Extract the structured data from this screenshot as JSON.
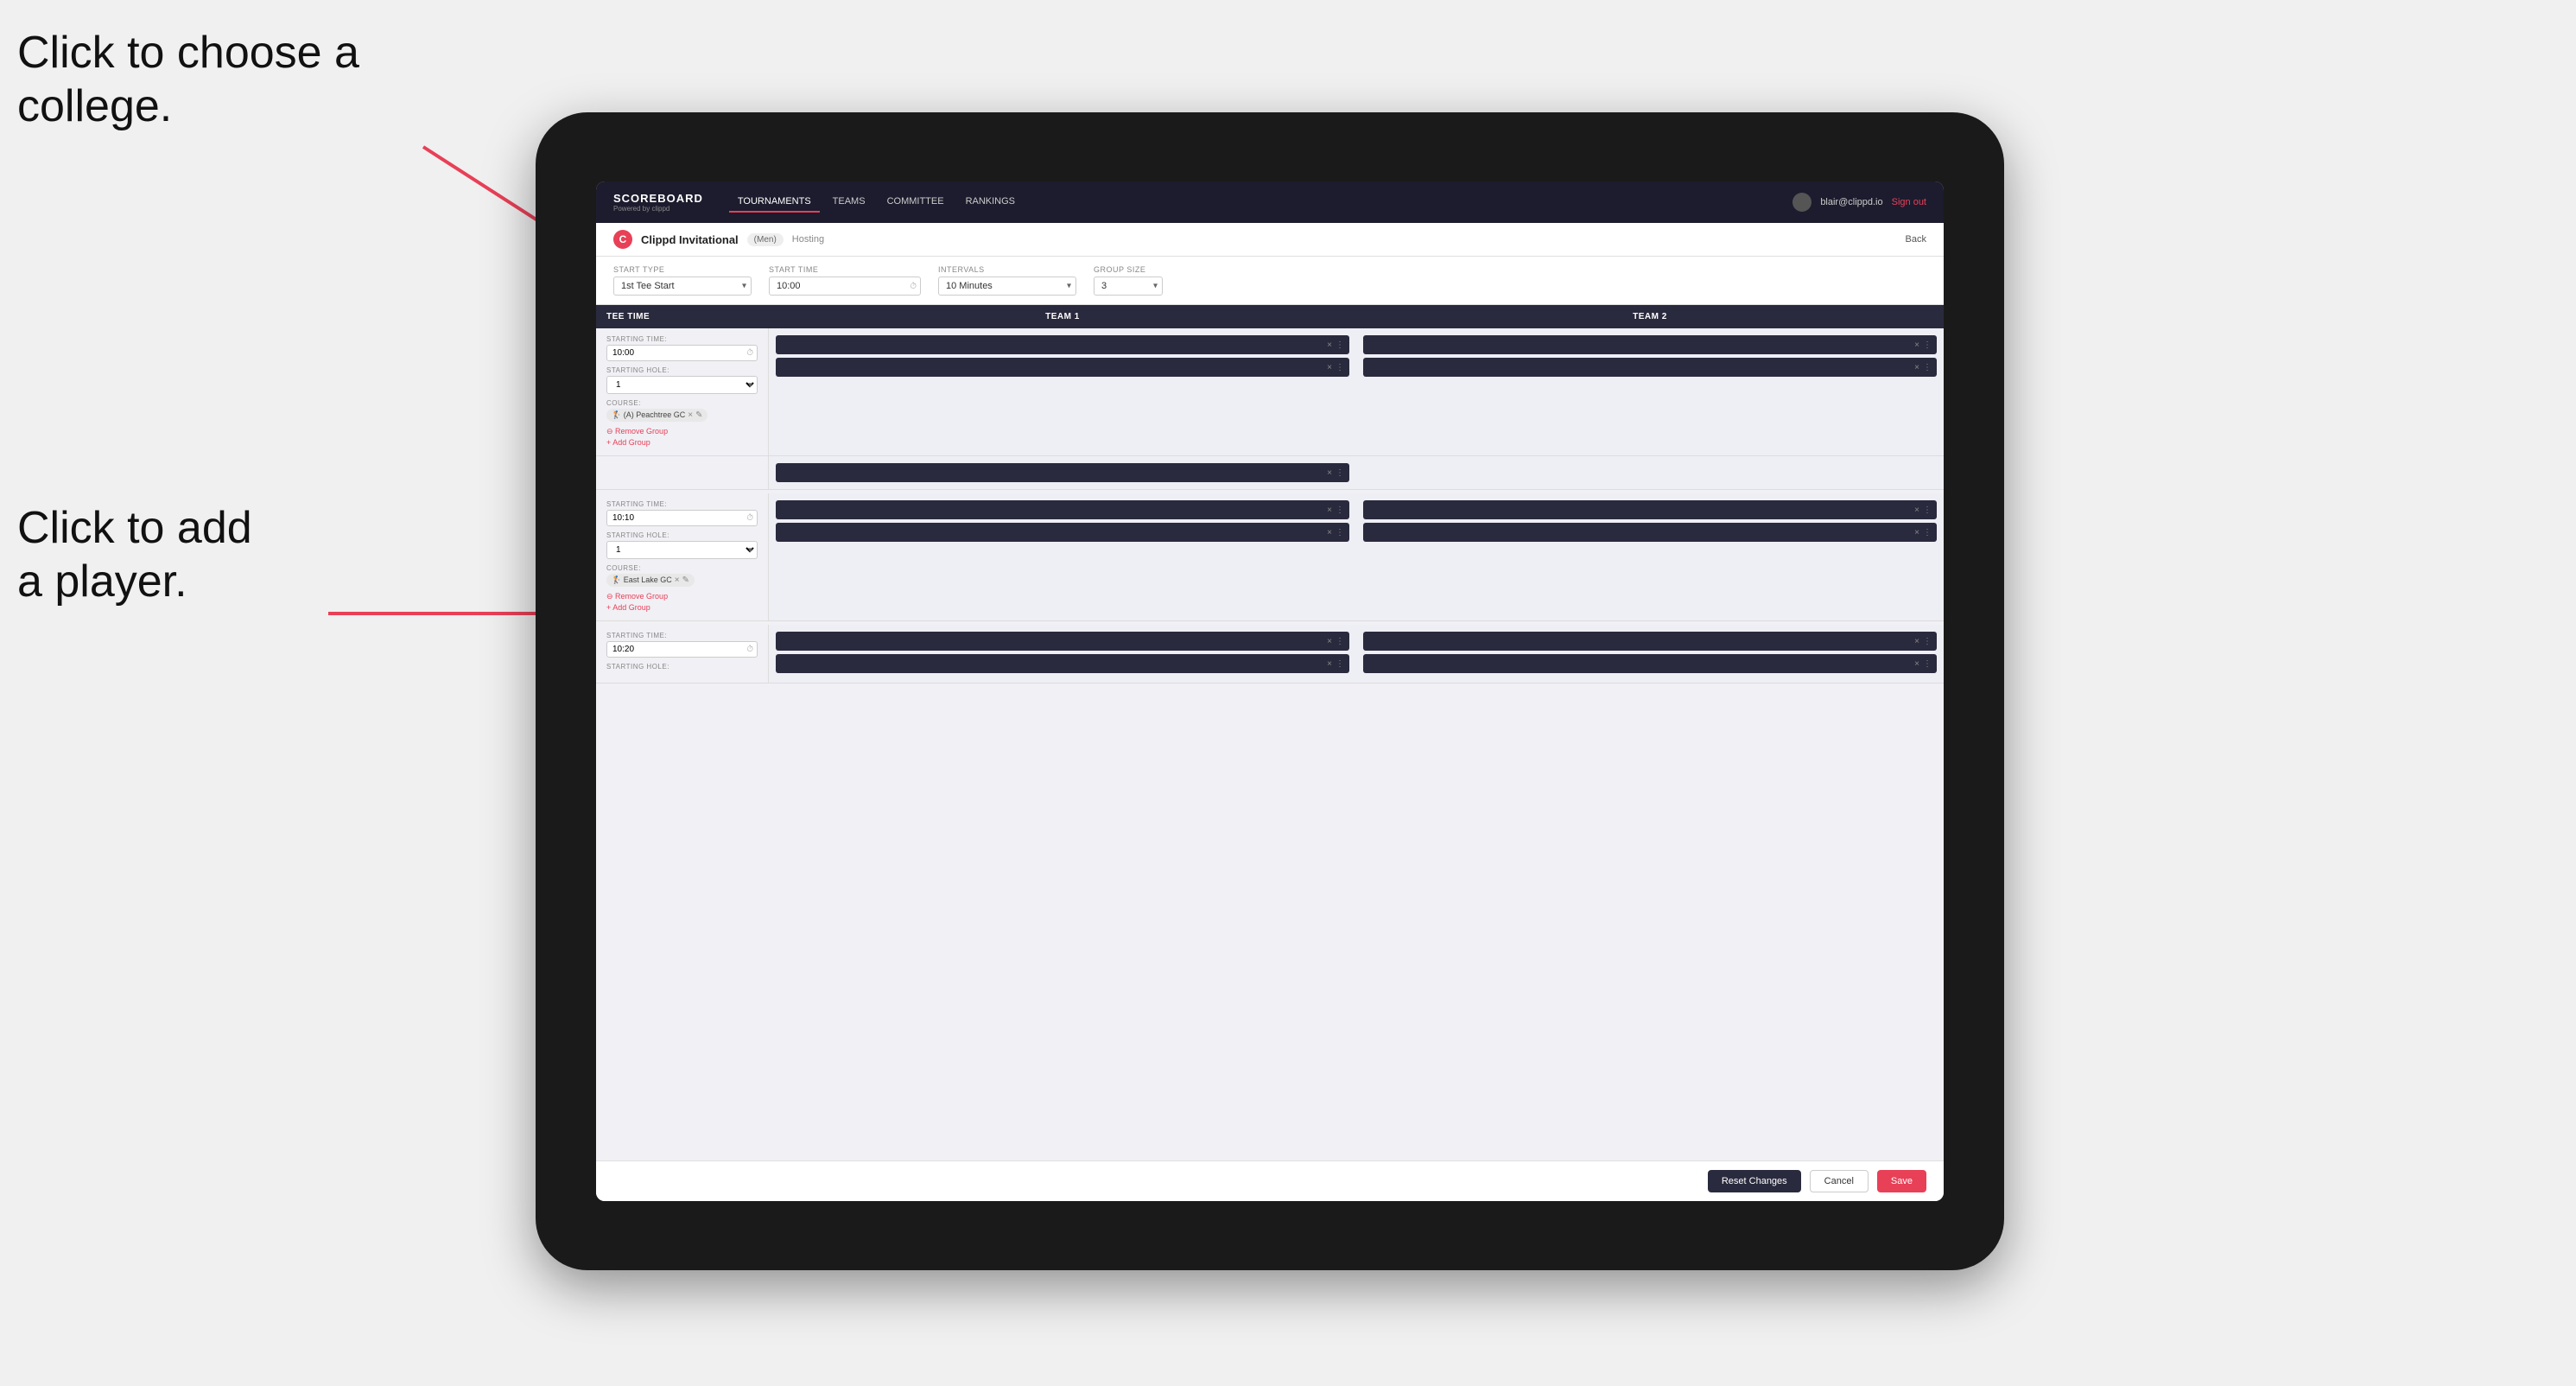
{
  "annotations": {
    "college": "Click to choose a\ncollege.",
    "player": "Click to add\na player."
  },
  "nav": {
    "logo": "SCOREBOARD",
    "logo_sub": "Powered by clippd",
    "links": [
      "TOURNAMENTS",
      "TEAMS",
      "COMMITTEE",
      "RANKINGS"
    ],
    "active_link": "TOURNAMENTS",
    "user_email": "blair@clippd.io",
    "sign_out": "Sign out"
  },
  "subheader": {
    "title": "Clippd Invitational",
    "badge": "(Men)",
    "hosting": "Hosting",
    "back": "Back"
  },
  "settings": {
    "start_type_label": "Start Type",
    "start_type_value": "1st Tee Start",
    "start_time_label": "Start Time",
    "start_time_value": "10:00",
    "intervals_label": "Intervals",
    "intervals_value": "10 Minutes",
    "group_size_label": "Group Size",
    "group_size_value": "3"
  },
  "table": {
    "col1": "Tee Time",
    "col2": "Team 1",
    "col3": "Team 2"
  },
  "groups": [
    {
      "starting_time": "10:00",
      "starting_hole": "1",
      "course": "(A) Peachtree GC",
      "team1_players": 2,
      "team2_players": 2
    },
    {
      "starting_time": "10:10",
      "starting_hole": "1",
      "course": "East Lake GC",
      "team1_players": 2,
      "team2_players": 2
    },
    {
      "starting_time": "10:20",
      "starting_hole": "",
      "course": "",
      "team1_players": 2,
      "team2_players": 2
    }
  ],
  "buttons": {
    "reset": "Reset Changes",
    "cancel": "Cancel",
    "save": "Save"
  }
}
